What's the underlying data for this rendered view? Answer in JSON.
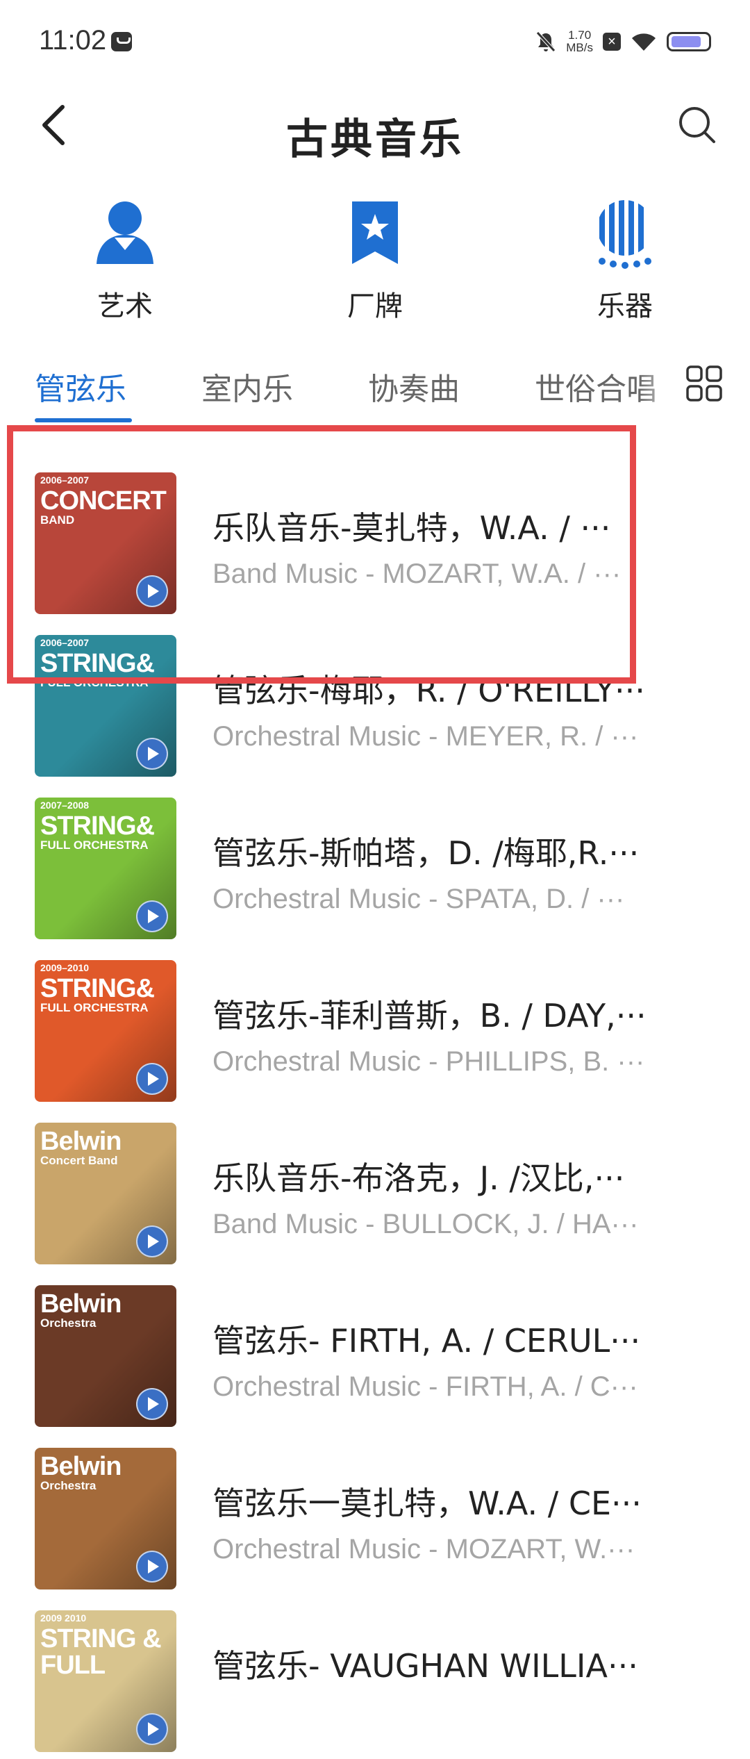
{
  "status": {
    "time": "11:02",
    "speed_value": "1.70",
    "speed_unit": "MB/s"
  },
  "header": {
    "title": "古典音乐"
  },
  "categories": [
    {
      "label": "艺术",
      "icon": "person-icon"
    },
    {
      "label": "厂牌",
      "icon": "badge-icon"
    },
    {
      "label": "乐器",
      "icon": "instrument-icon"
    }
  ],
  "tabs": [
    {
      "label": "管弦乐",
      "active": true
    },
    {
      "label": "室内乐",
      "active": false
    },
    {
      "label": "协奏曲",
      "active": false
    },
    {
      "label": "世俗合唱",
      "active": false
    }
  ],
  "items": [
    {
      "title": "乐队音乐-莫扎特，W.A. / ···",
      "subtitle": "Band Music - MOZART, W.A. / ···",
      "cover": {
        "year": "2006–2007",
        "big": "CONCERT",
        "small": "BAND",
        "bg": "#b8463a"
      }
    },
    {
      "title": "管弦乐-梅耶，R. / O'REILLY···",
      "subtitle": "Orchestral Music - MEYER, R. / ···",
      "cover": {
        "year": "2006–2007",
        "big": "STRING&",
        "small": "FULL ORCHESTRA",
        "bg": "#2d8a9a"
      }
    },
    {
      "title": "管弦乐-斯帕塔，D. /梅耶,R.···",
      "subtitle": "Orchestral Music - SPATA, D. / ···",
      "cover": {
        "year": "2007–2008",
        "big": "STRING&",
        "small": "FULL ORCHESTRA",
        "bg": "#7cbf3a"
      }
    },
    {
      "title": "管弦乐-菲利普斯，B. / DAY,···",
      "subtitle": "Orchestral Music - PHILLIPS, B. ···",
      "cover": {
        "year": "2009–2010",
        "big": "STRING&",
        "small": "FULL ORCHESTRA",
        "bg": "#e0592a"
      }
    },
    {
      "title": "乐队音乐-布洛克，J. /汉比,···",
      "subtitle": "Band Music - BULLOCK, J. / HA···",
      "cover": {
        "year": "",
        "big": "Belwin",
        "small": "Concert Band",
        "bg": "#c9a56a"
      }
    },
    {
      "title": "管弦乐- FIRTH, A. / CERUL···",
      "subtitle": "Orchestral Music - FIRTH, A. / C···",
      "cover": {
        "year": "",
        "big": "Belwin",
        "small": "Orchestra",
        "bg": "#6b3a26"
      }
    },
    {
      "title": "管弦乐一莫扎特，W.A. / CE···",
      "subtitle": "Orchestral Music - MOZART, W.···",
      "cover": {
        "year": "",
        "big": "Belwin",
        "small": "Orchestra",
        "bg": "#a46a3a"
      }
    },
    {
      "title": "管弦乐- VAUGHAN WILLIA···",
      "subtitle": "",
      "cover": {
        "year": "2009 2010",
        "big": "STRING & FULL",
        "small": "",
        "bg": "#d8c48e"
      }
    }
  ]
}
